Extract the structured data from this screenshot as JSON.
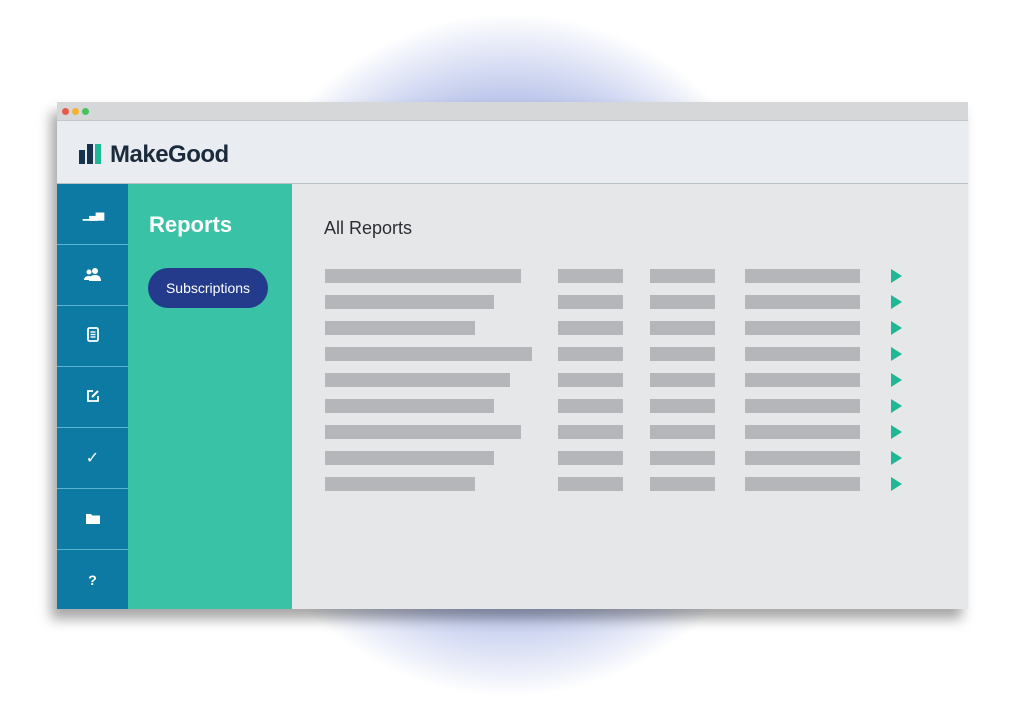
{
  "colors": {
    "rail": "#0d7aa4",
    "panel": "#39c2a5",
    "button": "#233b8a",
    "arrow": "#1eb894",
    "dot_red": "#e45b4d",
    "dot_yellow": "#f2b332",
    "dot_green": "#43c45f",
    "logo_dark": "#17324e",
    "logo_green": "#1eb894"
  },
  "app": {
    "brand": "MakeGood",
    "logo_icon": "bar-logo-icon"
  },
  "rail": {
    "items": [
      {
        "name": "rail-item-analytics",
        "icon": "bar-chart-icon",
        "glyph": "▁▃▅"
      },
      {
        "name": "rail-item-users",
        "icon": "users-icon",
        "glyph": "👥"
      },
      {
        "name": "rail-item-documents",
        "icon": "document-icon",
        "glyph": "▤"
      },
      {
        "name": "rail-item-edit",
        "icon": "edit-icon",
        "glyph": "✎"
      },
      {
        "name": "rail-item-tasks",
        "icon": "check-icon",
        "glyph": "✓"
      },
      {
        "name": "rail-item-files",
        "icon": "folder-icon",
        "glyph": "▬"
      },
      {
        "name": "rail-item-help",
        "icon": "help-icon",
        "glyph": "?"
      }
    ]
  },
  "panel": {
    "title": "Reports",
    "subscriptions_label": "Subscriptions"
  },
  "main": {
    "title": "All Reports",
    "row_count": 9,
    "row_action_icon": "play-arrow-icon"
  }
}
